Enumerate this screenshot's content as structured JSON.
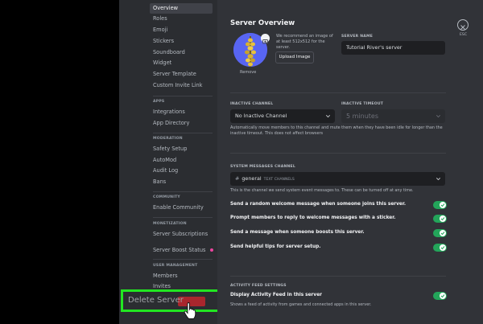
{
  "sidebar": {
    "items": [
      {
        "label": "Overview",
        "active": true
      },
      {
        "label": "Roles"
      },
      {
        "label": "Emoji"
      },
      {
        "label": "Stickers"
      },
      {
        "label": "Soundboard"
      },
      {
        "label": "Widget"
      },
      {
        "label": "Server Template"
      },
      {
        "label": "Custom Invite Link"
      }
    ],
    "apps_label": "APPS",
    "apps": [
      {
        "label": "Integrations"
      },
      {
        "label": "App Directory"
      }
    ],
    "moderation_label": "MODERATION",
    "moderation": [
      {
        "label": "Safety Setup"
      },
      {
        "label": "AutoMod"
      },
      {
        "label": "Audit Log"
      },
      {
        "label": "Bans"
      }
    ],
    "community_label": "COMMUNITY",
    "community": [
      {
        "label": "Enable Community"
      }
    ],
    "monetization_label": "MONETIZATION",
    "monetization": [
      {
        "label": "Server Subscriptions"
      }
    ],
    "boost_status": "Server Boost Status",
    "user_mgmt_label": "USER MANAGEMENT",
    "user_mgmt": [
      {
        "label": "Members"
      },
      {
        "label": "Invites"
      }
    ],
    "delete_label": "Delete Server"
  },
  "main": {
    "title": "Server Overview",
    "remove_label": "Remove",
    "recommend_text": "We recommend an image of at least 512x512 for the server.",
    "upload_label": "Upload Image",
    "server_name_label": "SERVER NAME",
    "server_name_value": "Tutorial River's server",
    "inactive_channel_label": "INACTIVE CHANNEL",
    "inactive_channel_value": "No Inactive Channel",
    "inactive_timeout_label": "INACTIVE TIMEOUT",
    "inactive_timeout_value": "5 minutes",
    "inactive_help": "Automatically move members to this channel and mute them when they have been idle for longer than the inactive timeout. This does not affect browsers",
    "system_channel_label": "SYSTEM MESSAGES CHANNEL",
    "system_channel_value": "general",
    "system_channel_tag": "TEXT CHANNELS",
    "system_help": "This is the channel we send system event messages to. These can be turned off at any time.",
    "toggles": [
      {
        "label": "Send a random welcome message when someone joins this server.",
        "on": true
      },
      {
        "label": "Prompt members to reply to welcome messages with a sticker.",
        "on": true
      },
      {
        "label": "Send a message when someone boosts this server.",
        "on": true
      },
      {
        "label": "Send helpful tips for server setup.",
        "on": true
      }
    ],
    "activity_label": "ACTIVITY FEED SETTINGS",
    "activity_toggle": "Display Activity Feed in this server",
    "activity_help": "Shows a feed of activity from games and connected apps in this server.",
    "esc_label": "ESC"
  },
  "colors": {
    "accent": "#5865f2",
    "toggle_on": "#23a55a",
    "danger": "#c0262d",
    "highlight": "#22e622"
  }
}
